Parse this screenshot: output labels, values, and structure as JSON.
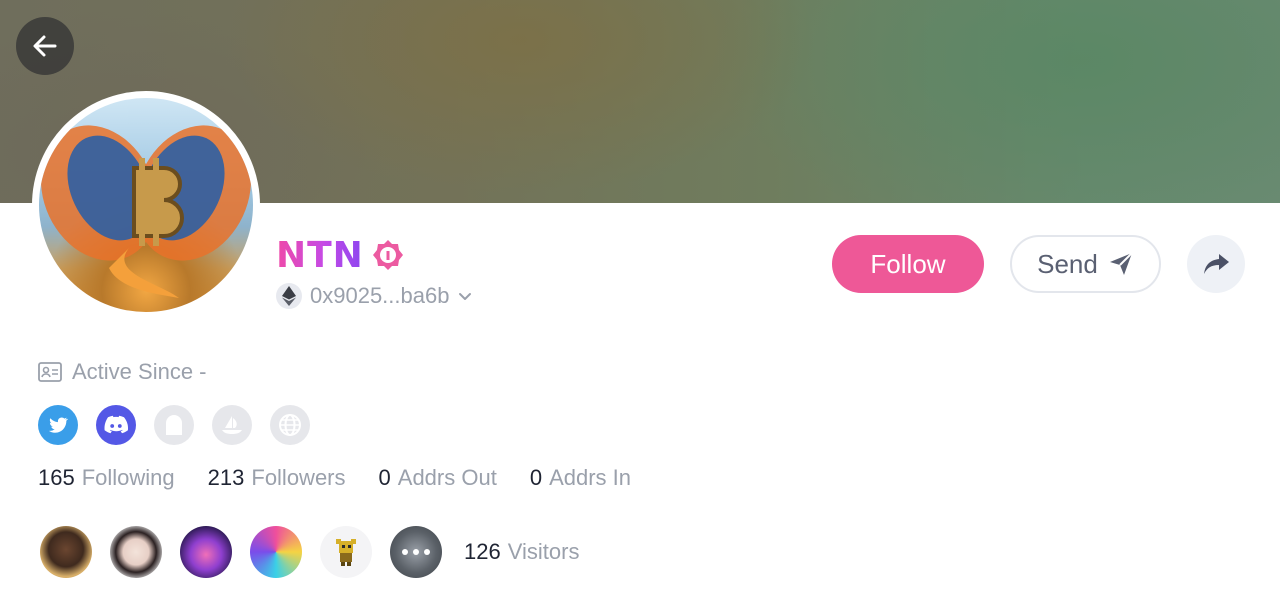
{
  "profile": {
    "name": "NTN",
    "address": "0x9025...ba6b",
    "active_since": "Active Since -"
  },
  "actions": {
    "follow_label": "Follow",
    "send_label": "Send"
  },
  "socials": [
    {
      "icon": "twitter-icon",
      "active": true
    },
    {
      "icon": "discord-icon",
      "active": true
    },
    {
      "icon": "ghost-icon",
      "active": false
    },
    {
      "icon": "opensea-icon",
      "active": false
    },
    {
      "icon": "globe-icon",
      "active": false
    }
  ],
  "stats": {
    "following": {
      "value": "165",
      "label": "Following"
    },
    "followers": {
      "value": "213",
      "label": "Followers"
    },
    "addrs_out": {
      "value": "0",
      "label": "Addrs Out"
    },
    "addrs_in": {
      "value": "0",
      "label": "Addrs In"
    }
  },
  "visitors": {
    "count": "126",
    "label": "Visitors"
  },
  "colors": {
    "accent_pink": "#ee5897",
    "name_gradient_start": "#ef4aa8",
    "name_gradient_end": "#8b46f0",
    "twitter_blue": "#3a9ee9",
    "discord_purple": "#5458e6"
  }
}
